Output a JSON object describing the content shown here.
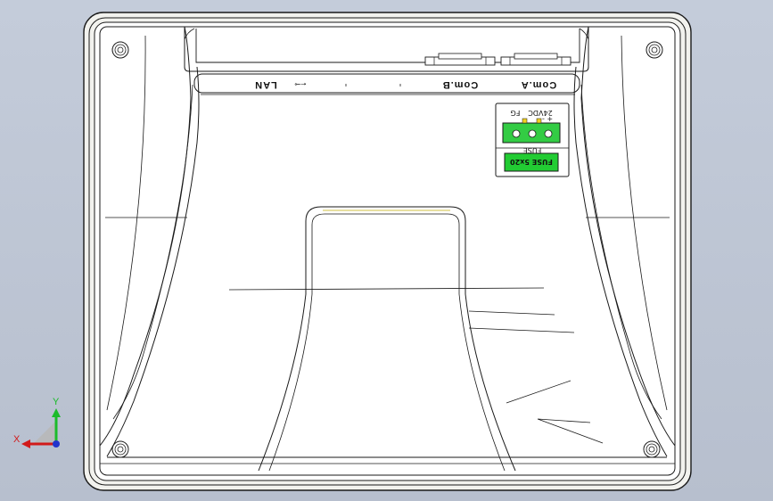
{
  "labels": {
    "lan": "LAN",
    "usb_symbol": "⭠⊸",
    "com_b": "Com.B",
    "com_a": "Com.A",
    "power_polarity": "+ -",
    "power_voltage": "24VDC",
    "power_ground": "FG",
    "fuse_label": "FUSE",
    "fuse_rating": "FUSE 5x20"
  },
  "triad": {
    "x_label": "X",
    "y_label": "Y"
  },
  "colors": {
    "background_top": "#c4ccda",
    "background_bottom": "#b7bfce",
    "panel_fill": "#ffffff",
    "bezel_fill": "#f2f2ee",
    "edge_color": "#1a1a1a",
    "terminal_green": "#33cc44",
    "fuse_green": "#22cc33",
    "axis_x": "#d11a1a",
    "axis_y": "#1bbb2a",
    "axis_z": "#2233cc"
  }
}
